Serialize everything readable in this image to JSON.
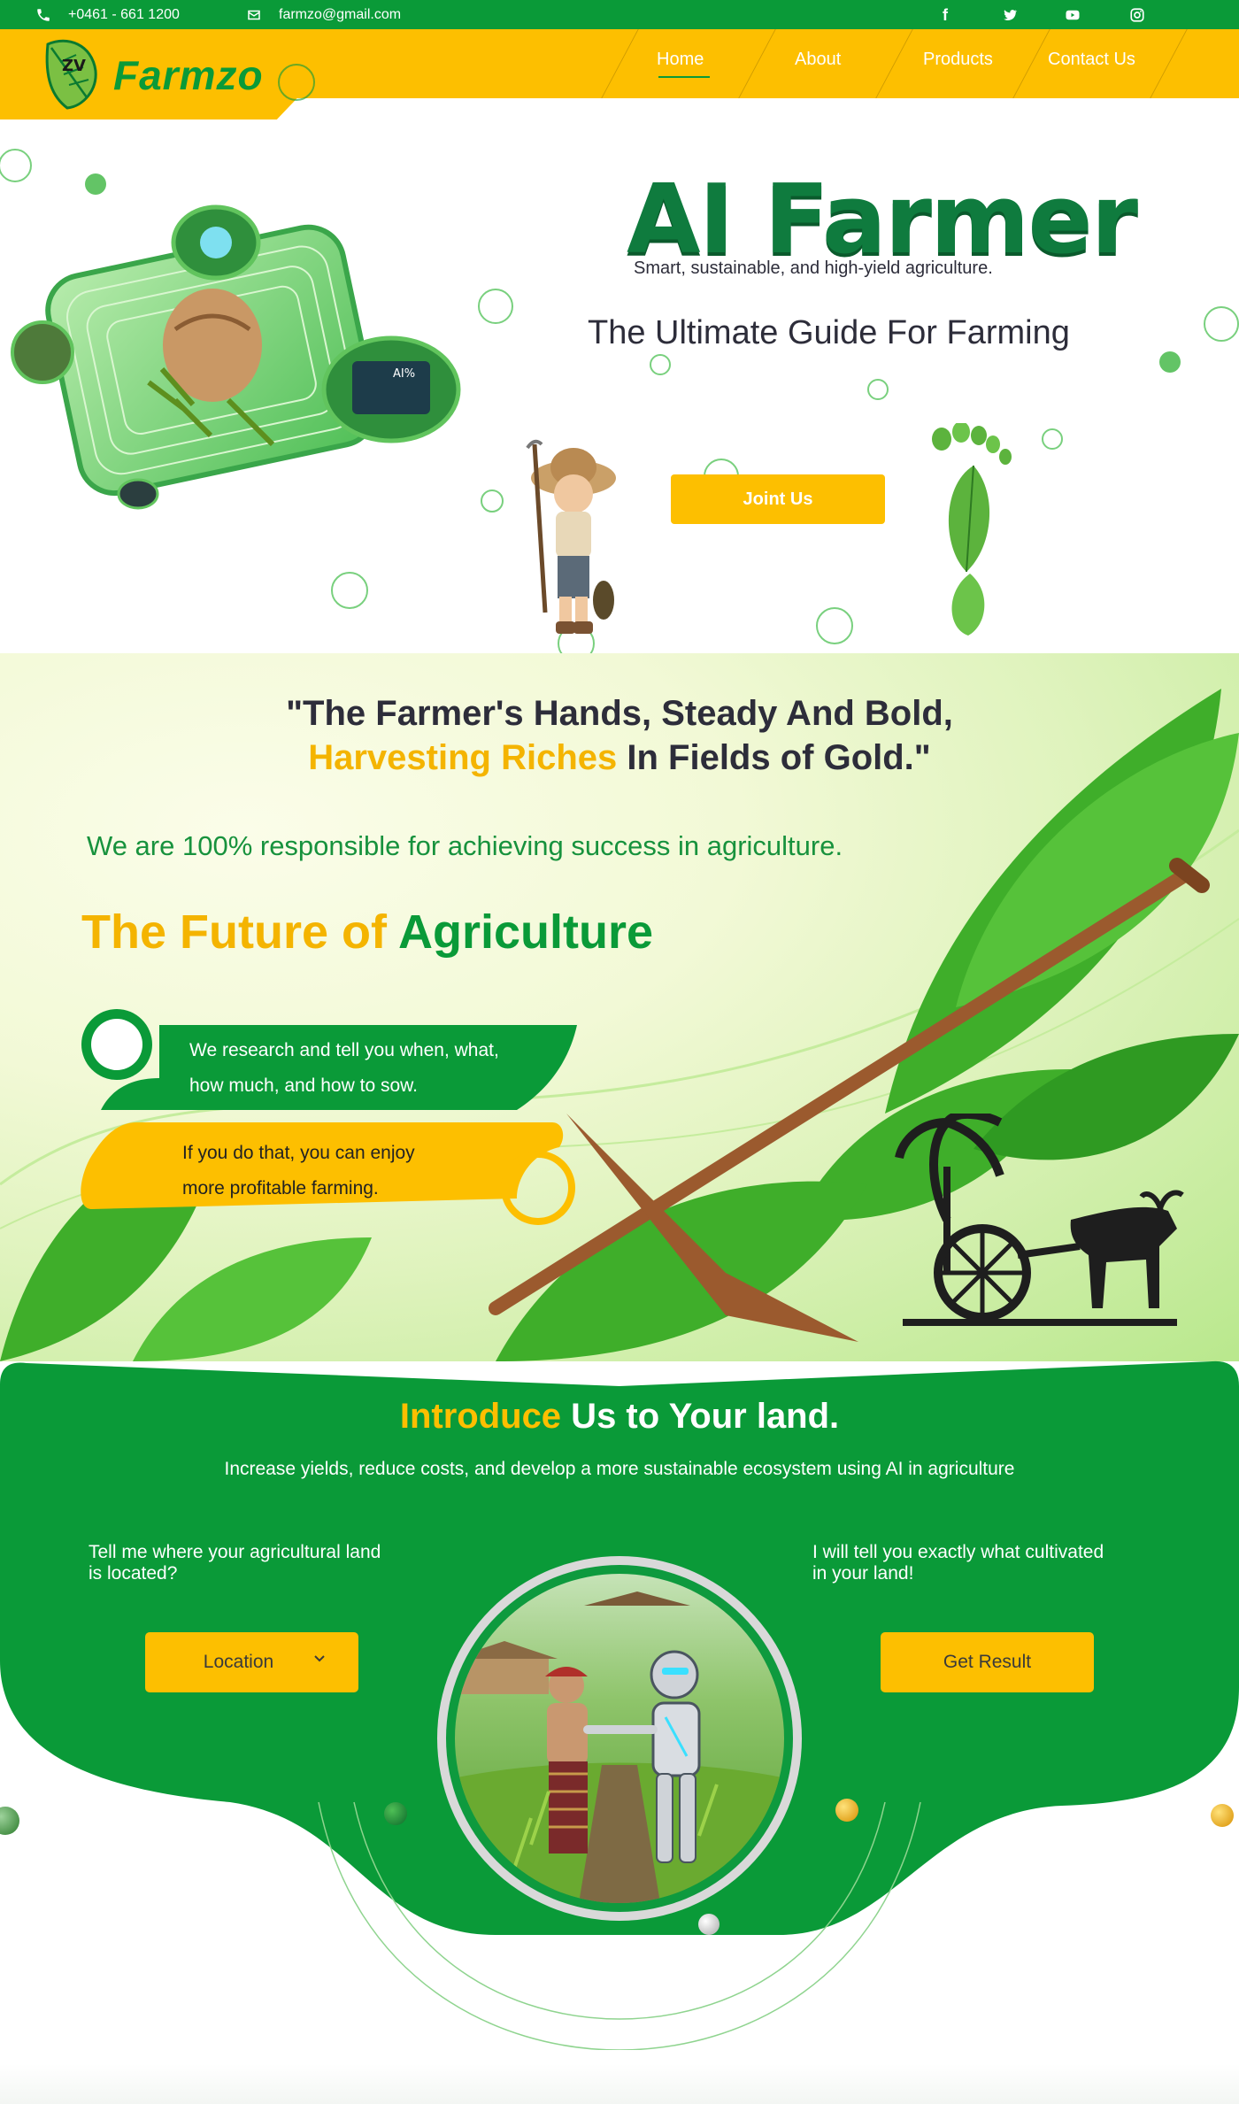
{
  "topbar": {
    "phone": "+0461 - 661 1200",
    "email": "farmzo@gmail.com",
    "social": [
      "facebook-icon",
      "twitter-icon",
      "youtube-icon",
      "instagram-icon"
    ]
  },
  "brand": {
    "name": "Farmzo"
  },
  "nav": {
    "items": [
      "Home",
      "About",
      "Products",
      "Contact Us"
    ],
    "active": "Home"
  },
  "hero": {
    "logo_title": "AI Farmer",
    "tagline": "Smart, sustainable, and high-yield agriculture.",
    "guide": "The Ultimate Guide For Farming",
    "cta": "Joint Us"
  },
  "quote": {
    "line1": "\"The Farmer's Hands, Steady And Bold,",
    "line2_highlight": "Harvesting Riches",
    "line2_rest": " In Fields of Gold.\""
  },
  "responsible": "We are 100% responsible for achieving success in agriculture.",
  "future": {
    "part1": "The Future of ",
    "part2": "Agriculture"
  },
  "pills": {
    "green_line1": "We research and tell you when, what,",
    "green_line2": "how much, and how to sow.",
    "yellow_line1": "If you do that, you can enjoy",
    "yellow_line2": "more profitable farming."
  },
  "introduce": {
    "title_highlight": "Introduce",
    "title_rest": " Us to Your land.",
    "subtitle": "Increase yields, reduce costs, and develop a more sustainable ecosystem using AI in agriculture",
    "left_q1": "Tell me where your agricultural land",
    "left_q2": "is located?",
    "right_q1": "I will  tell you exactly what cultivated",
    "right_q2": "in your land!",
    "location_button": "Location",
    "result_button": "Get Result"
  },
  "colors": {
    "primary_green": "#0a9a38",
    "accent_yellow": "#fdbf00",
    "text_dark": "#2d2d3a"
  }
}
